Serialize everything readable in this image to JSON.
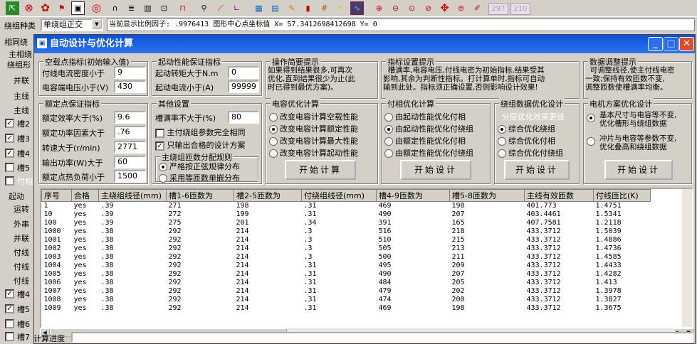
{
  "toolbar": {
    "icons": [
      "exit-icon",
      "stop-icon",
      "settings-icon",
      "flag-icon",
      "window-icon",
      "target-icon",
      "magnet-icon",
      "stack-icon",
      "chart-icon",
      "zoom-window-icon",
      "rect-icon",
      "wrench-icon",
      "curve-icon",
      "axis-icon",
      "calculator-icon",
      "book-icon",
      "tag-icon",
      "stripes-icon",
      "grid-icon",
      "pencil-yellow-icon",
      "wave-icon",
      "zoom-in-icon",
      "zoom-out-icon",
      "zoom-fit-icon",
      "zoom-prev-icon",
      "pan-icon",
      "zoom-page-icon",
      "pen-icon"
    ],
    "num1": "297",
    "num2": "210"
  },
  "status": {
    "label": "绕组种类",
    "combo_value": "单绕组正交",
    "info": "当前显示比例因子: .9976413  图形中心点坐标值 X= 57.3412698412698 Y= 0"
  },
  "left_panel": {
    "labels": [
      "相同绕",
      "主相绕",
      "绕组形",
      "并联",
      "主线",
      "主线",
      "槽2",
      "槽3",
      "槽4",
      "槽5",
      "付相绕",
      "起动",
      "运转",
      "外串",
      "并联",
      "付线",
      "付线",
      "槽4",
      "槽5",
      "槽6",
      "槽7"
    ],
    "checks": [
      true,
      true,
      false,
      false,
      false,
      true,
      true,
      false
    ]
  },
  "dialog": {
    "title": "自动设计与优化计算",
    "noload": {
      "title": "空载点指标(初始输入值)",
      "fields": [
        {
          "label": "付线电流密度小于",
          "value": "9"
        },
        {
          "label": "电容端电压小于(V)",
          "value": "430"
        }
      ]
    },
    "startperf": {
      "title": "起动性能保证指标",
      "fields": [
        {
          "label": "起动转矩大于N.m",
          "value": "0"
        },
        {
          "label": "起动电流小于(A)",
          "value": "99999"
        }
      ]
    },
    "rated": {
      "title": "额定点保证指标",
      "fields": [
        {
          "label": "额定效率大于(%)",
          "value": "9.6"
        },
        {
          "label": "额定功率因素大于",
          "value": ".76"
        },
        {
          "label": "转速大于(r/min)",
          "value": "2771"
        },
        {
          "label": "输出功率(W)大于",
          "value": "60"
        },
        {
          "label": "额定点热负荷小于",
          "value": "1500"
        }
      ]
    },
    "other": {
      "title": "其他设置",
      "slot_label": "槽满率不大于(%)",
      "slot_value": "80",
      "check1": "主付绕组参数完全相同",
      "check2": "只输出合格的设计方案",
      "dist_title": "主绕组匝数分配规则",
      "dist1": "严格按正弦规律分布",
      "dist2": "采用等匝数单嵌分布"
    },
    "tips": [
      {
        "title": "操作简要提示",
        "text": "如果得到结果很多,可再次\n优化,直到结果很少为止(此\n时已得到最优方案)。"
      },
      {
        "title": "指标设置提示",
        "text": "  槽满率,电容电压,付线电密为初始指标,结果受其\n影响,其余为判断性指标。打计算单时,指标可自动\n输到此处。指标须正确设置,否则影响设计效果!"
      },
      {
        "title": "数据调整提示",
        "text": "  可调整线径,使主付线电密\n一致;保持有效匝数不变,\n调整匝数使槽满率均衡。"
      }
    ],
    "cap": {
      "title": "电容优化计算",
      "options": [
        "改变电容计算空载性能",
        "改变电容计算额定性能",
        "改变电容计算最大性能",
        "改变电容计算起动性能"
      ],
      "selected": 1,
      "button": "开始计算"
    },
    "aux": {
      "title": "付相优化计算",
      "options": [
        "由起动性能优化付相",
        "由起动性能优化付绕组",
        "由额定性能优化付相",
        "由额定性能优化付绕组"
      ],
      "selected": 1,
      "button": "开始设计"
    },
    "winding": {
      "title": "绕组数据优化设计",
      "subtitle": "分层优化效果更佳",
      "options": [
        "综合优化绕组",
        "综合优化付相",
        "综合优化付绕组"
      ],
      "selected": 0,
      "button": "开始设计"
    },
    "motor": {
      "title": "电机方案优化设计",
      "options": [
        "基本尺寸与电容等不变,\n优化槽形与绕组数据",
        "冲片与电容等参数不变,\n优化叠高和绕组数据"
      ],
      "selected": 0,
      "button": "开始设计"
    },
    "table": {
      "headers": [
        "序号",
        "合格",
        "主绕组线径(mm)",
        "槽1-6匝数为",
        "槽2-5匝数为",
        "付绕组线径(mm)",
        "槽4-9匝数为",
        "槽5-8匝数为",
        "主线有效匝数",
        "付线匝比(K)"
      ],
      "rows": [
        [
          "1",
          "yes",
          ".39",
          "271",
          "198",
          ".31",
          "469",
          "198",
          "401.773",
          "1.4751"
        ],
        [
          "10",
          "yes",
          ".39",
          "272",
          "199",
          ".31",
          "490",
          "207",
          "403.4461",
          "1.5341"
        ],
        [
          "100",
          "yes",
          ".39",
          "275",
          "201",
          ".34",
          "391",
          "165",
          "407.7581",
          "1.2118"
        ],
        [
          "1000",
          "yes",
          ".38",
          "292",
          "214",
          ".3",
          "516",
          "218",
          "433.3712",
          "1.5039"
        ],
        [
          "1001",
          "yes",
          ".38",
          "292",
          "214",
          ".3",
          "510",
          "215",
          "433.3712",
          "1.4886"
        ],
        [
          "1002",
          "yes",
          ".38",
          "292",
          "214",
          ".3",
          "505",
          "213",
          "433.3712",
          "1.4736"
        ],
        [
          "1003",
          "yes",
          ".38",
          "292",
          "214",
          ".3",
          "500",
          "211",
          "433.3712",
          "1.4585"
        ],
        [
          "1004",
          "yes",
          ".38",
          "292",
          "214",
          ".31",
          "495",
          "209",
          "433.3712",
          "1.4433"
        ],
        [
          "1005",
          "yes",
          ".38",
          "292",
          "214",
          ".31",
          "490",
          "207",
          "433.3712",
          "1.4282"
        ],
        [
          "1006",
          "yes",
          ".38",
          "292",
          "214",
          ".31",
          "484",
          "205",
          "433.3712",
          "1.413"
        ],
        [
          "1007",
          "yes",
          ".38",
          "292",
          "214",
          ".31",
          "479",
          "202",
          "433.3712",
          "1.3978"
        ],
        [
          "1008",
          "yes",
          ".38",
          "292",
          "214",
          ".31",
          "474",
          "200",
          "433.3712",
          "1.3827"
        ],
        [
          "1009",
          "yes",
          ".38",
          "292",
          "214",
          ".31",
          "469",
          "198",
          "433.3712",
          "1.3675"
        ]
      ]
    },
    "progress_label": "计算进度"
  }
}
